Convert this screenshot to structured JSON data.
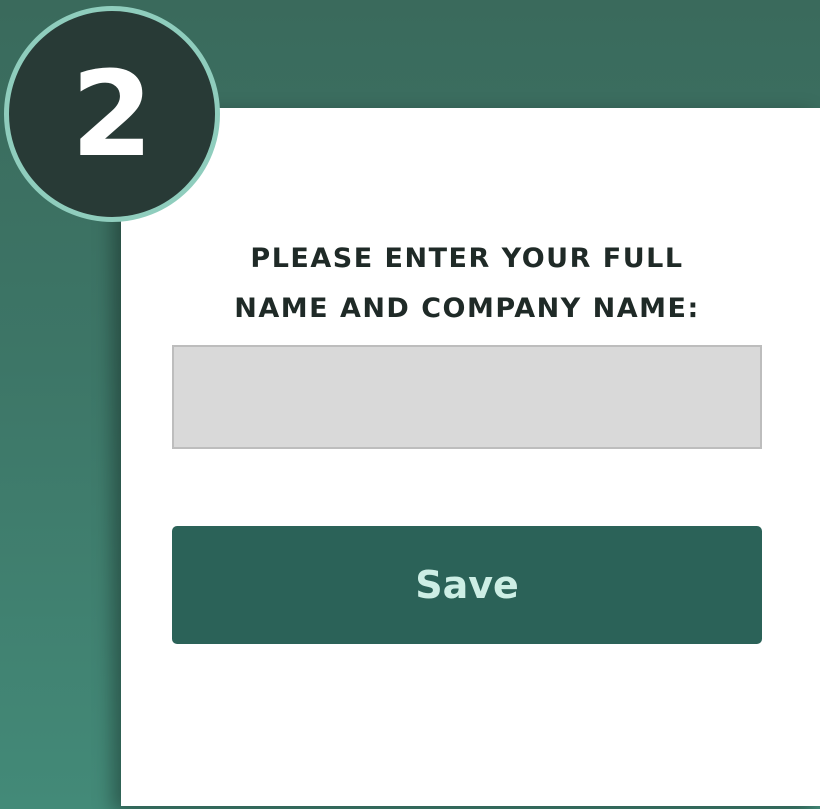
{
  "step_badge": {
    "number": "2"
  },
  "form": {
    "prompt_line1": "PLEASE ENTER YOUR FULL",
    "prompt_line2": "NAME AND COMPANY NAME:",
    "name_input_value": "",
    "save_label": "Save"
  },
  "colors": {
    "background": "#3d7667",
    "card": "#ffffff",
    "badge_fill": "#283a36",
    "badge_ring": "#8fcdbd",
    "input_fill": "#d9d9d9",
    "button_fill": "#2b6258",
    "button_text": "#cdeee5",
    "prompt_text": "#1f2a27"
  }
}
